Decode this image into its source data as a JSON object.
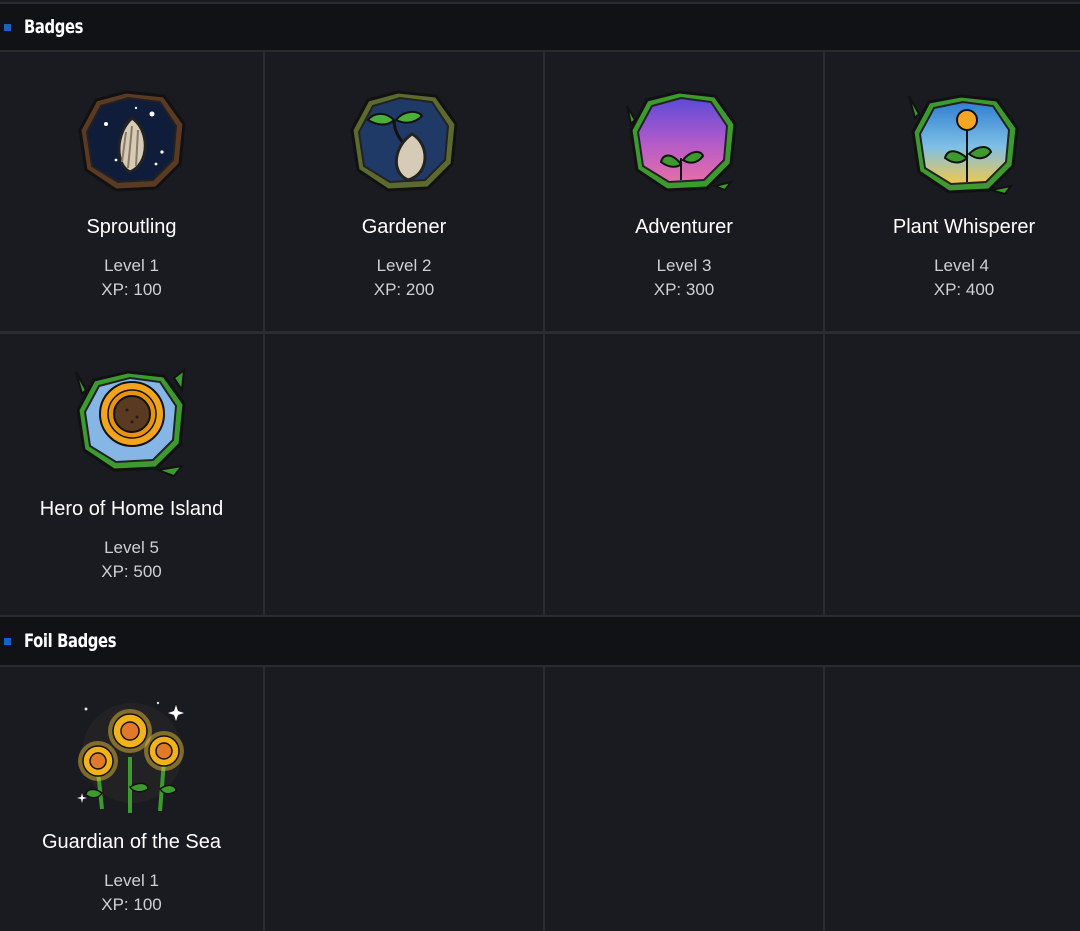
{
  "sections": {
    "badges": {
      "title": "Badges"
    },
    "foil": {
      "title": "Foil Badges"
    }
  },
  "badges": [
    {
      "name": "Sproutling",
      "level": "Level 1",
      "xp": "XP: 100",
      "icon": "seed-night-sky-icon"
    },
    {
      "name": "Gardener",
      "level": "Level 2",
      "xp": "XP: 200",
      "icon": "sprouting-seed-icon"
    },
    {
      "name": "Adventurer",
      "level": "Level 3",
      "xp": "XP: 300",
      "icon": "sunset-sprout-icon"
    },
    {
      "name": "Plant Whisperer",
      "level": "Level 4",
      "xp": "XP: 400",
      "icon": "flower-sunrise-icon"
    },
    {
      "name": "Hero of Home Island",
      "level": "Level 5",
      "xp": "XP: 500",
      "icon": "sunflower-wreath-icon"
    }
  ],
  "foil_badges": [
    {
      "name": "Guardian of the Sea",
      "level": "Level 1",
      "xp": "XP: 100",
      "icon": "sparkling-sunflowers-icon"
    }
  ],
  "colors": {
    "background": "#1a1b1f",
    "header": "#111215",
    "accent": "#1f5fbf",
    "divider": "#2b2c31",
    "vine_green": "#3c9a2e"
  }
}
